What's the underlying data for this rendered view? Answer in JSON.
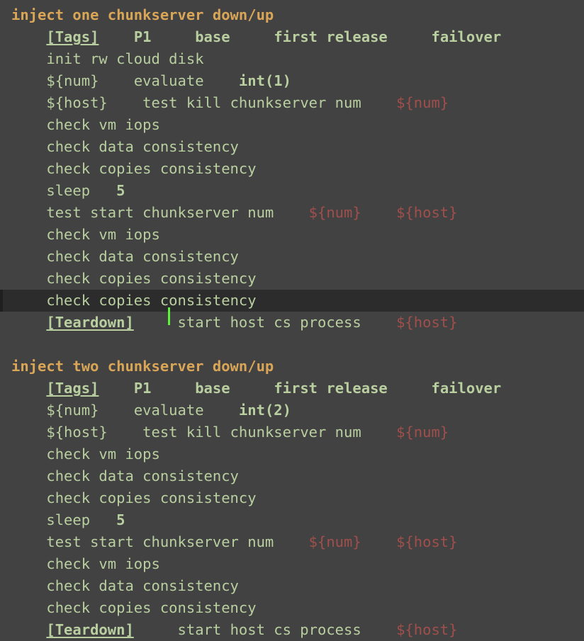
{
  "theme": {
    "background": "#424242",
    "current_line_background": "#2c2c2c",
    "default_text": "#b9cfa0",
    "title_color": "#d9a557",
    "argument_color": "#a04f4c",
    "cursor_color": "#5ef23c"
  },
  "cursor": {
    "line_index": 13,
    "column_after_text": "check copies c"
  },
  "lines": [
    {
      "type": "testcase-title",
      "text": "inject one chunkserver down/up"
    },
    {
      "type": "settings",
      "setting": "[Tags]",
      "tags": [
        "P1",
        "base",
        "first release",
        "failover"
      ]
    },
    {
      "type": "keyword",
      "text": "init rw cloud disk"
    },
    {
      "type": "assignment",
      "variable": "${num}",
      "keyword": "evaluate",
      "argument_bold": "int(1)"
    },
    {
      "type": "assignment-args",
      "variable": "${host}",
      "keyword": "test kill chunkserver num",
      "arguments": [
        "${num}"
      ]
    },
    {
      "type": "keyword",
      "text": "check vm iops"
    },
    {
      "type": "keyword",
      "text": "check data consistency"
    },
    {
      "type": "keyword",
      "text": "check copies consistency"
    },
    {
      "type": "keyword-bold-arg",
      "keyword": "sleep",
      "argument": "5"
    },
    {
      "type": "keyword-args",
      "keyword": "test start chunkserver num",
      "arguments": [
        "${num}",
        "${host}"
      ]
    },
    {
      "type": "keyword",
      "text": "check vm iops"
    },
    {
      "type": "keyword",
      "text": "check data consistency"
    },
    {
      "type": "keyword",
      "text": "check copies consistency"
    },
    {
      "type": "keyword-cursor",
      "text_before_cursor": "check copies c",
      "text_after_cursor": "onsistency"
    },
    {
      "type": "teardown",
      "setting": "[Teardown]",
      "keyword": "start host cs process",
      "arguments": [
        "${host}"
      ]
    },
    {
      "type": "blank",
      "text": ""
    },
    {
      "type": "testcase-title",
      "text": "inject two chunkserver down/up"
    },
    {
      "type": "settings",
      "setting": "[Tags]",
      "tags": [
        "P1",
        "base",
        "first release",
        "failover"
      ]
    },
    {
      "type": "assignment",
      "variable": "${num}",
      "keyword": "evaluate",
      "argument_bold": "int(2)"
    },
    {
      "type": "assignment-args",
      "variable": "${host}",
      "keyword": "test kill chunkserver num",
      "arguments": [
        "${num}"
      ]
    },
    {
      "type": "keyword",
      "text": "check vm iops"
    },
    {
      "type": "keyword",
      "text": "check data consistency"
    },
    {
      "type": "keyword",
      "text": "check copies consistency"
    },
    {
      "type": "keyword-bold-arg",
      "keyword": "sleep",
      "argument": "5"
    },
    {
      "type": "keyword-args",
      "keyword": "test start chunkserver num",
      "arguments": [
        "${num}",
        "${host}"
      ]
    },
    {
      "type": "keyword",
      "text": "check vm iops"
    },
    {
      "type": "keyword",
      "text": "check data consistency"
    },
    {
      "type": "keyword",
      "text": "check copies consistency"
    },
    {
      "type": "teardown",
      "setting": "[Teardown]",
      "keyword": "start host cs process",
      "arguments": [
        "${host}"
      ]
    }
  ]
}
